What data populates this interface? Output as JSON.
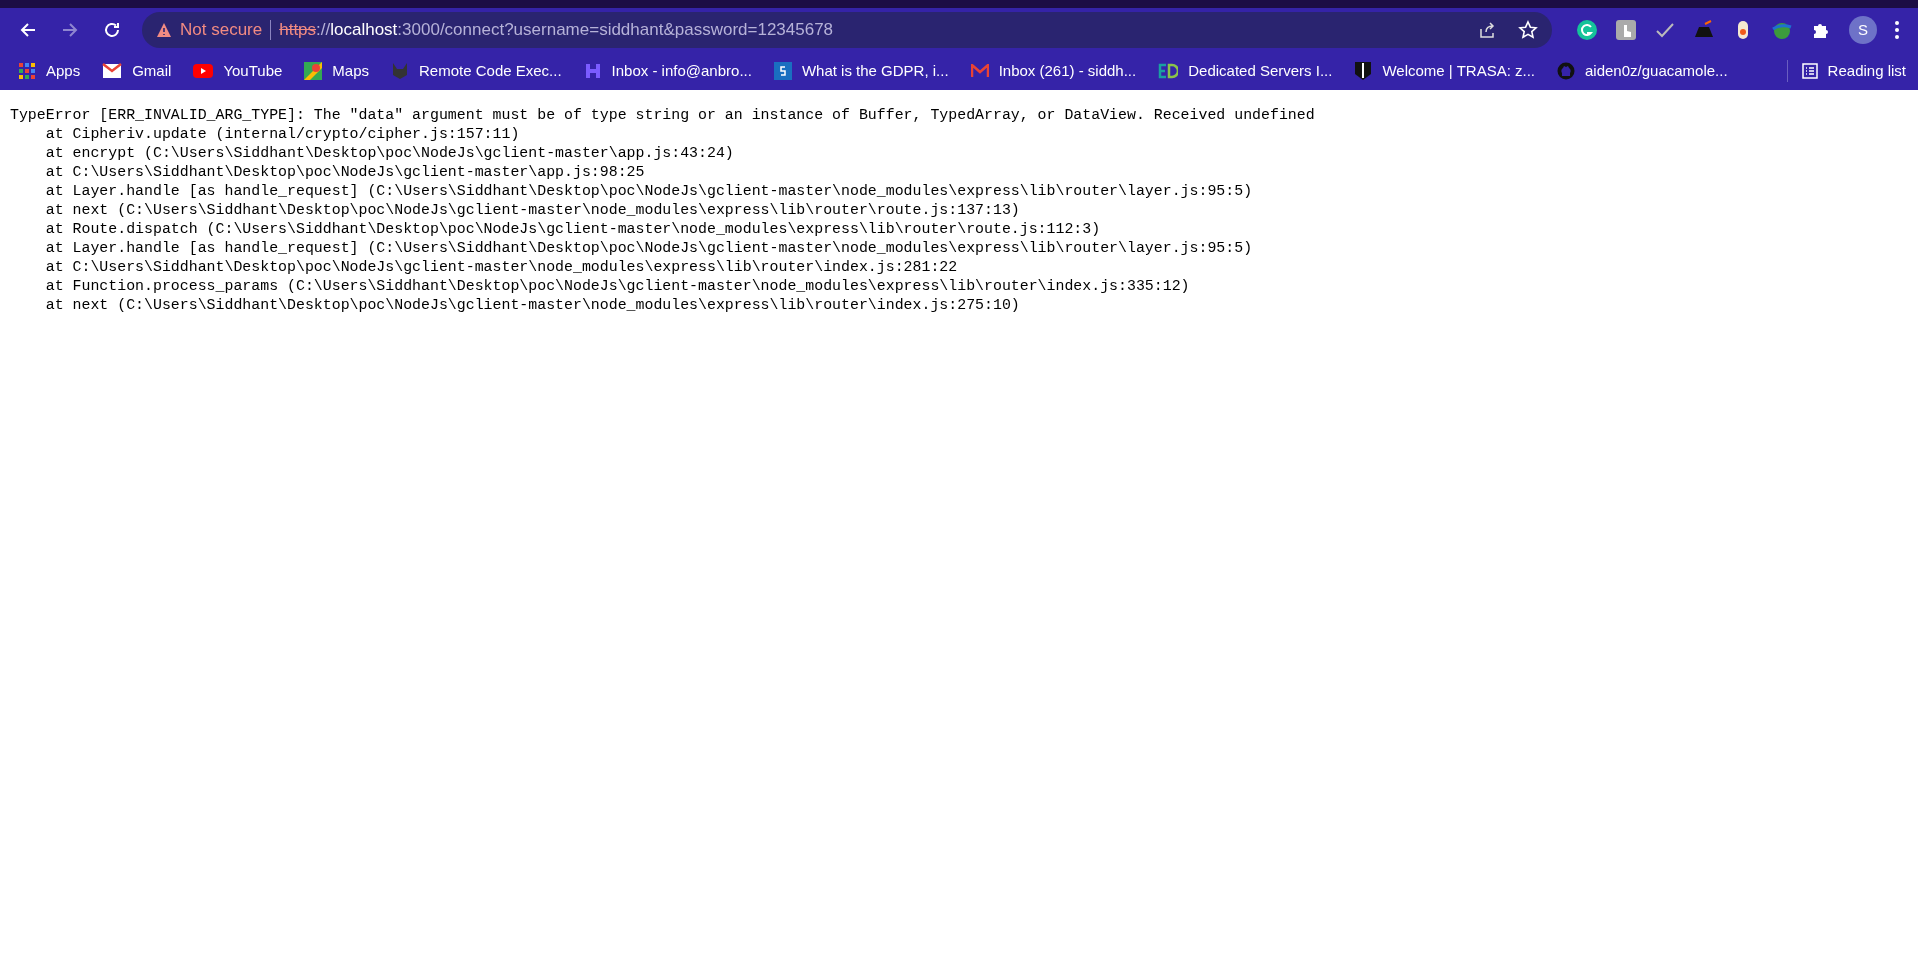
{
  "toolbar": {
    "security": {
      "label": "Not secure",
      "secure": false
    },
    "url": {
      "scheme": "https",
      "separator": "://",
      "host": "localhost",
      "rest": ":3000/connect?username=siddhant&password=12345678"
    },
    "profile": {
      "initial": "S"
    }
  },
  "bookmarks": [
    {
      "label": "Apps"
    },
    {
      "label": "Gmail"
    },
    {
      "label": "YouTube"
    },
    {
      "label": "Maps"
    },
    {
      "label": "Remote Code Exec..."
    },
    {
      "label": "Inbox - info@anbro..."
    },
    {
      "label": "What is the GDPR, i..."
    },
    {
      "label": "Inbox (261) - siddh..."
    },
    {
      "label": "Dedicated Servers I..."
    },
    {
      "label": "Welcome | TRASA: z..."
    },
    {
      "label": "aiden0z/guacamole..."
    }
  ],
  "reading_list": {
    "label": "Reading list"
  },
  "error": {
    "message": "TypeError [ERR_INVALID_ARG_TYPE]: The \"data\" argument must be of type string or an instance of Buffer, TypedArray, or DataView. Received undefined",
    "stack": [
      "    at Cipheriv.update (internal/crypto/cipher.js:157:11)",
      "    at encrypt (C:\\Users\\Siddhant\\Desktop\\poc\\NodeJs\\gclient-master\\app.js:43:24)",
      "    at C:\\Users\\Siddhant\\Desktop\\poc\\NodeJs\\gclient-master\\app.js:98:25",
      "    at Layer.handle [as handle_request] (C:\\Users\\Siddhant\\Desktop\\poc\\NodeJs\\gclient-master\\node_modules\\express\\lib\\router\\layer.js:95:5)",
      "    at next (C:\\Users\\Siddhant\\Desktop\\poc\\NodeJs\\gclient-master\\node_modules\\express\\lib\\router\\route.js:137:13)",
      "    at Route.dispatch (C:\\Users\\Siddhant\\Desktop\\poc\\NodeJs\\gclient-master\\node_modules\\express\\lib\\router\\route.js:112:3)",
      "    at Layer.handle [as handle_request] (C:\\Users\\Siddhant\\Desktop\\poc\\NodeJs\\gclient-master\\node_modules\\express\\lib\\router\\layer.js:95:5)",
      "    at C:\\Users\\Siddhant\\Desktop\\poc\\NodeJs\\gclient-master\\node_modules\\express\\lib\\router\\index.js:281:22",
      "    at Function.process_params (C:\\Users\\Siddhant\\Desktop\\poc\\NodeJs\\gclient-master\\node_modules\\express\\lib\\router\\index.js:335:12)",
      "    at next (C:\\Users\\Siddhant\\Desktop\\poc\\NodeJs\\gclient-master\\node_modules\\express\\lib\\router\\index.js:275:10)"
    ]
  }
}
